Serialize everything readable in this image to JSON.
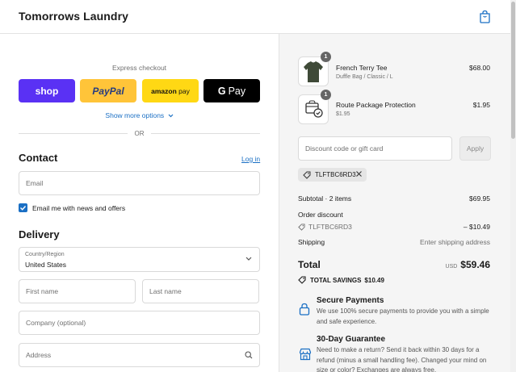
{
  "header": {
    "brand": "Tomorrows Laundry",
    "cart_icon": "shopping-bag-icon"
  },
  "express": {
    "label": "Express checkout",
    "buttons": {
      "shop": "shop",
      "paypal": "PayPal",
      "amazon_a": "amazon",
      "amazon_b": "pay",
      "gpay_g": "G",
      "gpay_text": "Pay"
    },
    "show_more": "Show more options",
    "or": "OR"
  },
  "contact": {
    "title": "Contact",
    "login": "Log in",
    "email_placeholder": "Email",
    "newsletter_label": "Email me with news and offers",
    "newsletter_checked": true
  },
  "delivery": {
    "title": "Delivery",
    "country_label": "Country/Region",
    "country_value": "United States",
    "first_name_placeholder": "First name",
    "last_name_placeholder": "Last name",
    "company_placeholder": "Company (optional)",
    "address_placeholder": "Address"
  },
  "order": {
    "items": [
      {
        "name": "French Terry Tee",
        "variant": "Duffle Bag / Classic / L",
        "qty": "1",
        "price": "$68.00"
      },
      {
        "name": "Route Package Protection",
        "variant": "$1.95",
        "qty": "1",
        "price": "$1.95"
      }
    ],
    "discount_placeholder": "Discount code or gift card",
    "apply": "Apply",
    "applied_code": "TLFTBC6RD3",
    "subtotal_label": "Subtotal · 2 items",
    "subtotal_value": "$69.95",
    "order_discount_label": "Order discount",
    "order_discount_code": "TLFTBC6RD3",
    "order_discount_value": "– $10.49",
    "shipping_label": "Shipping",
    "shipping_value": "Enter shipping address",
    "total_label": "Total",
    "total_currency": "USD",
    "total_value": "$59.46",
    "savings_label": "TOTAL SAVINGS",
    "savings_value": "$10.49"
  },
  "features": [
    {
      "icon": "lock-icon",
      "title": "Secure Payments",
      "body": "We use 100% secure payments to provide you with a simple and safe experience."
    },
    {
      "icon": "store-icon",
      "title": "30-Day Guarantee",
      "body": "Need to make a return? Send it back within 30 days for a refund (minus a small handling fee). Changed your mind on size or color? Exchanges are always free."
    }
  ],
  "colors": {
    "accent": "#1a6fc4",
    "shop": "#5a31f4",
    "paypal": "#ffc439",
    "amazon": "#ffd814",
    "gpay": "#000000",
    "summary_bg": "#f5f5f5"
  }
}
